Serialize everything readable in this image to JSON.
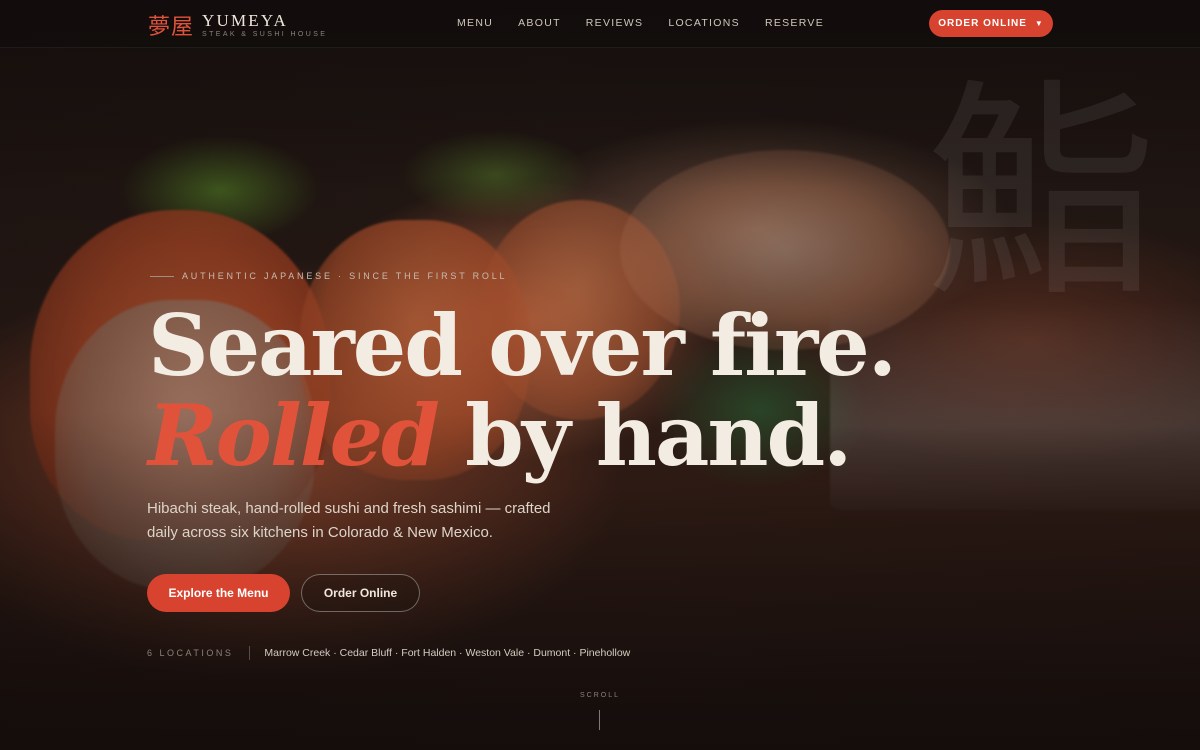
{
  "brand": {
    "mark": "夢屋",
    "name": "YUMEYA",
    "tagline": "STEAK & SUSHI HOUSE"
  },
  "nav": {
    "items": [
      "MENU",
      "ABOUT",
      "REVIEWS",
      "LOCATIONS",
      "RESERVE"
    ]
  },
  "header": {
    "order_label": "ORDER ONLINE",
    "order_caret": "▼"
  },
  "hero": {
    "eyebrow": "AUTHENTIC JAPANESE · SINCE THE FIRST ROLL",
    "headline_line1": "Seared over fire.",
    "headline_accent": "Rolled",
    "headline_line2_rest": " by hand.",
    "lede": "Hibachi steak, hand-rolled sushi and fresh sashimi — crafted daily across six kitchens in Colorado & New Mexico.",
    "primary_cta": "Explore the Menu",
    "secondary_cta": "Order Online",
    "watermark_kanji": "鮨"
  },
  "locations": {
    "count_label": "6 LOCATIONS",
    "list": "Marrow Creek · Cedar Bluff · Fort Halden · Weston Vale · Dumont · Pinehollow"
  },
  "scroll": {
    "label": "SCROLL"
  },
  "colors": {
    "accent": "#d8432f",
    "headline": "#f3ece2",
    "header_bg": "#120e0d"
  }
}
